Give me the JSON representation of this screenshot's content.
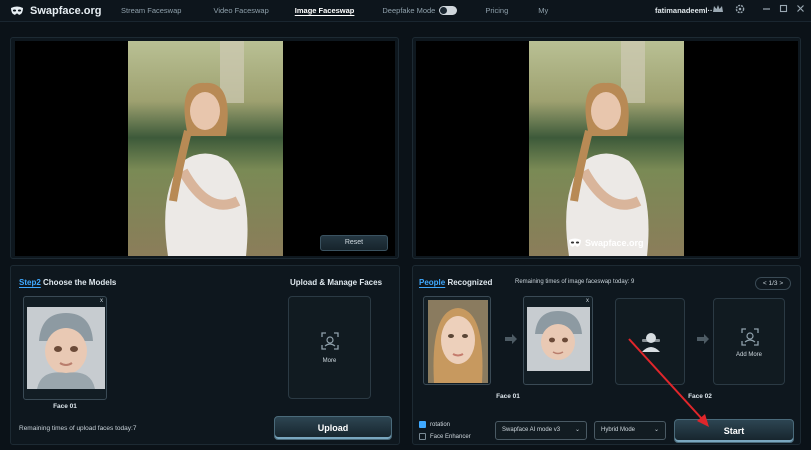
{
  "app": {
    "name": "Swapface.org",
    "logo_icon": "mask-icon"
  },
  "nav": {
    "items": [
      "Stream Faceswap",
      "Video Faceswap",
      "Image Faceswap",
      "Deepfake Mode",
      "Pricing",
      "My"
    ],
    "active": "Image Faceswap"
  },
  "user": {
    "name": "fatimanadeeml··"
  },
  "top_icons": [
    "crown-icon",
    "settings-icon",
    "minimize-icon",
    "maximize-icon",
    "close-icon"
  ],
  "viewer": {
    "reset_label": "Reset",
    "watermark": "Swapface.org"
  },
  "models": {
    "title_accent": "Step2",
    "title_rest": " Choose the Models",
    "upload_title": "Upload & Manage Faces",
    "face_label": "Face 01",
    "more_label": "More",
    "remaining_text": "Remaining times of upload faces today:7",
    "upload_label": "Upload",
    "close_mark": "x"
  },
  "people": {
    "title_accent": "People",
    "title_rest": " Recognized",
    "remaining_text": "Remaining times of image faceswap today: 9",
    "pager": "< 1/3 >",
    "face1_label": "Face 01",
    "face2_label": "Face 02",
    "add_more_label": "Add More",
    "close_mark": "x",
    "rotation_label": "rotation",
    "rotation_checked": true,
    "enhancer_label": "Face Enhancer",
    "enhancer_checked": false,
    "mode_select": "Swapface AI mode v3",
    "hybrid_select": "Hybrid Mode",
    "start_label": "Start"
  },
  "colors": {
    "accent": "#3fa9ff",
    "annotation_arrow": "#e0262b"
  }
}
